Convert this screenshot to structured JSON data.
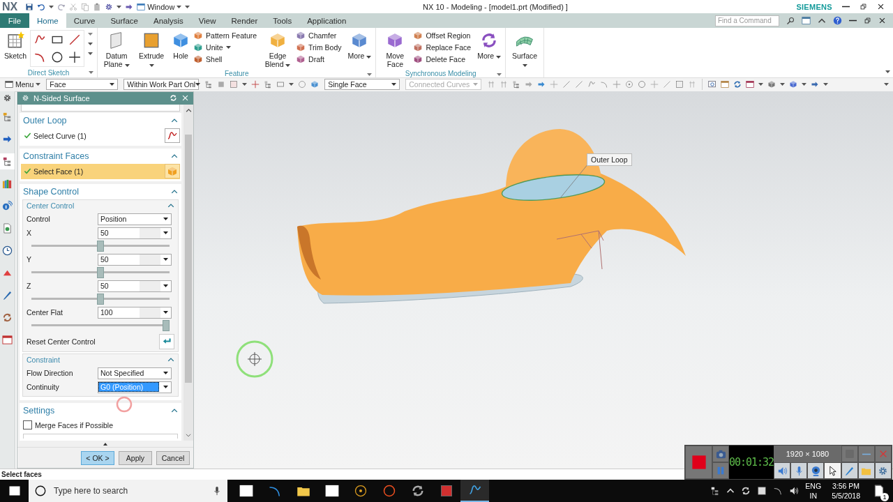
{
  "window": {
    "logo": "NX",
    "window_menu": "Window",
    "title": "NX 10 - Modeling - [model1.prt (Modified) ]",
    "brand": "SIEMENS"
  },
  "ribbon_tabs": [
    {
      "label": "File",
      "kind": "file",
      "selected": false
    },
    {
      "label": "Home",
      "kind": "tab",
      "selected": true
    },
    {
      "label": "Curve",
      "kind": "tab",
      "selected": false
    },
    {
      "label": "Surface",
      "kind": "tab",
      "selected": false
    },
    {
      "label": "Analysis",
      "kind": "tab",
      "selected": false
    },
    {
      "label": "View",
      "kind": "tab",
      "selected": false
    },
    {
      "label": "Render",
      "kind": "tab",
      "selected": false
    },
    {
      "label": "Tools",
      "kind": "tab",
      "selected": false
    },
    {
      "label": "Application",
      "kind": "tab",
      "selected": false
    }
  ],
  "command_finder": {
    "placeholder": "Find a Command"
  },
  "ribbon_groups": [
    {
      "title": "Direct Sketch",
      "items": [
        {
          "kind": "large",
          "label": "Sketch",
          "dropdown": false
        },
        {
          "kind": "grid"
        }
      ]
    },
    {
      "title": "Feature",
      "items": [
        {
          "kind": "large",
          "label": "Datum Plane",
          "dropdown": true
        },
        {
          "kind": "large",
          "label": "Extrude",
          "dropdown": true
        },
        {
          "kind": "large",
          "label": "Hole",
          "dropdown": false
        },
        {
          "kind": "stack",
          "commands": [
            {
              "label": "Pattern Feature",
              "dropdown": false
            },
            {
              "label": "Unite",
              "dropdown": true
            },
            {
              "label": "Shell",
              "dropdown": false
            }
          ]
        },
        {
          "kind": "large",
          "label": "Edge Blend",
          "dropdown": true
        },
        {
          "kind": "stack",
          "commands": [
            {
              "label": "Chamfer",
              "dropdown": false
            },
            {
              "label": "Trim Body",
              "dropdown": false
            },
            {
              "label": "Draft",
              "dropdown": false
            }
          ]
        },
        {
          "kind": "large",
          "label": "More",
          "dropdown": true
        }
      ]
    },
    {
      "title": "Synchronous Modeling",
      "items": [
        {
          "kind": "large",
          "label": "Move Face",
          "dropdown": false
        },
        {
          "kind": "stack",
          "commands": [
            {
              "label": "Offset Region",
              "dropdown": false
            },
            {
              "label": "Replace Face",
              "dropdown": false
            },
            {
              "label": "Delete Face",
              "dropdown": false
            }
          ]
        },
        {
          "kind": "large",
          "label": "More",
          "dropdown": true
        }
      ]
    },
    {
      "items": [
        {
          "kind": "large",
          "label": "Surface",
          "dropdown": true
        }
      ]
    }
  ],
  "selection_bar": {
    "menu": "Menu",
    "filters": [
      {
        "value": "Face",
        "disabled": false
      },
      {
        "value": "Within Work Part Onl",
        "disabled": false
      },
      {
        "value": "Single Face",
        "disabled": false
      },
      {
        "value": "Connected Curves",
        "disabled": true
      }
    ]
  },
  "resource_tabs": [
    {
      "selected": false
    },
    {
      "selected": false
    },
    {
      "selected": true
    },
    {
      "selected": false
    },
    {
      "selected": false
    },
    {
      "selected": false
    },
    {
      "selected": false
    },
    {
      "selected": false
    },
    {
      "selected": false
    },
    {
      "selected": false
    },
    {
      "selected": false
    }
  ],
  "dialog": {
    "title": "N-Sided Surface",
    "sections": [
      {
        "title": "Outer Loop",
        "expanded": true,
        "rows": [
          {
            "kind": "selector",
            "label": "Select Curve (1)",
            "done": true,
            "selected": false
          }
        ]
      },
      {
        "title": "Constraint Faces",
        "expanded": true,
        "rows": [
          {
            "kind": "selector",
            "label": "Select Face (1)",
            "done": true,
            "selected": true
          }
        ]
      },
      {
        "title": "Shape Control",
        "expanded": true,
        "groups": [
          {
            "title": "Center Control",
            "expanded": true,
            "rows": [
              {
                "kind": "dropdown",
                "label": "Control",
                "value": "Position",
                "selected": false
              },
              {
                "kind": "slider",
                "label": "X",
                "value": "50",
                "level": 0.5
              },
              {
                "kind": "slider",
                "label": "Y",
                "value": "50",
                "level": 0.5
              },
              {
                "kind": "slider",
                "label": "Z",
                "value": "50",
                "level": 0.5
              },
              {
                "kind": "slider",
                "label": "Center Flat",
                "value": "100",
                "level": 1
              },
              {
                "kind": "action",
                "label": "Reset Center Control"
              }
            ]
          },
          {
            "title": "Constraint",
            "expanded": true,
            "rows": [
              {
                "kind": "dropdown",
                "label": "Flow Direction",
                "value": "Not Specified",
                "selected": false
              },
              {
                "kind": "dropdown",
                "label": "Continuity",
                "value": "G0 (Position)",
                "selected": true
              }
            ]
          }
        ]
      },
      {
        "title": "Settings",
        "expanded": true,
        "rows": [
          {
            "kind": "checkbox",
            "label": "Merge Faces if Possible",
            "checked": false
          },
          {
            "kind": "truncated"
          }
        ]
      }
    ],
    "buttons": [
      {
        "label": "< OK >",
        "default": true
      },
      {
        "label": "Apply",
        "default": false
      },
      {
        "label": "Cancel",
        "default": false
      }
    ]
  },
  "viewport": {
    "callout": "Outer Loop"
  },
  "status_bar": {
    "message": "Select faces"
  },
  "recorder": {
    "timer": "00:01:32",
    "resolution": "1920 × 1080"
  },
  "taskbar": {
    "search": {
      "placeholder": "Type here to search"
    },
    "apps": [
      {
        "active": false
      },
      {
        "active": false
      },
      {
        "active": false
      },
      {
        "active": false
      },
      {
        "active": false
      },
      {
        "active": false
      },
      {
        "active": false
      },
      {
        "active": false
      },
      {
        "active": true
      }
    ],
    "language": "ENG",
    "region": "IN",
    "time": "3:56 PM",
    "date": "5/5/2018",
    "notifications": "1"
  }
}
